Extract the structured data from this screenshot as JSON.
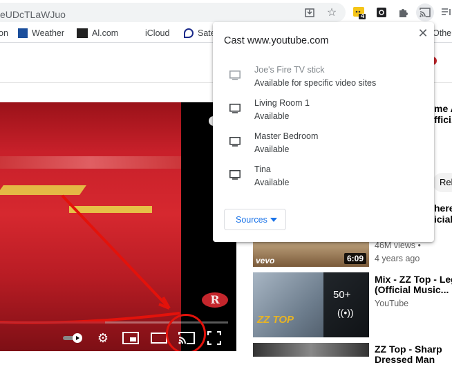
{
  "browser": {
    "url": "eUDcTLaWJuo",
    "toolbar_icons": [
      "install-icon",
      "star-icon",
      "extension-badge-icon",
      "camera-extension-icon",
      "puzzle-icon",
      "cast-icon",
      "reading-list-icon"
    ],
    "extension_badge": "4"
  },
  "bookmarks": {
    "items": [
      {
        "label": "on"
      },
      {
        "label": "Weather"
      },
      {
        "label": "Al.com"
      },
      {
        "label": "iCloud"
      },
      {
        "label": "Sate"
      },
      {
        "label": "Other"
      }
    ]
  },
  "cast": {
    "title": "Cast www.youtube.com",
    "close_label": "✕",
    "sinks": [
      {
        "name": "Joe's Fire TV stick",
        "status": "Available for specific video sites",
        "enabled": false
      },
      {
        "name": "Living Room 1",
        "status": "Available",
        "enabled": true
      },
      {
        "name": "Master Bedroom",
        "status": "Available",
        "enabled": true
      },
      {
        "name": "Tina",
        "status": "Available",
        "enabled": true
      }
    ],
    "sources_label": "Sources"
  },
  "player": {
    "progress": 0.46,
    "logo": "R"
  },
  "sidebar": {
    "partial_title_1a": "me A",
    "partial_title_1b": "ffici.",
    "rel_button": "Rel",
    "partial_title_2a": "here",
    "partial_title_2b": "icial.",
    "video1": {
      "views": "46M views •",
      "age": "4 years ago",
      "duration": "6:09",
      "channel_logo": "vevo"
    },
    "video2": {
      "title_line1": "Mix - ZZ Top - Leg",
      "title_line2": "(Official Music...",
      "channel": "YouTube",
      "count": "50+",
      "logo": "ZZ TOP"
    },
    "video3": {
      "title_line1": "ZZ Top - Sharp",
      "title_line2": "Dressed Man"
    }
  },
  "colors": {
    "accent": "#1a73e8",
    "youtube_red": "#c4262c",
    "annotation_red": "#e3120b"
  }
}
